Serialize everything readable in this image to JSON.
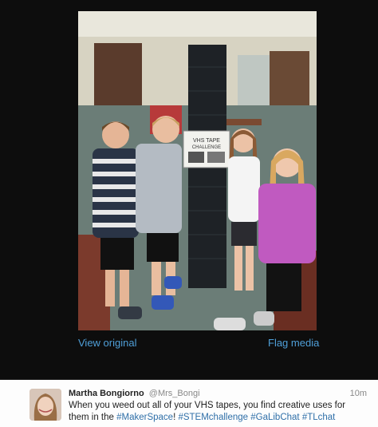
{
  "photo": {
    "sign_title": "VHS TAPE",
    "sign_subtitle": "CHALLENGE"
  },
  "actions": {
    "view_original": "View original",
    "flag_media": "Flag media"
  },
  "tweet": {
    "author_name": "Martha Bongiorno",
    "handle": "@Mrs_Bongi",
    "time": "10m",
    "text_part1": "When you weed out all of your VHS tapes, you find creative uses for them in the ",
    "hashtag_makerspace": "#MakerSpace",
    "text_part2": "! ",
    "hashtag_stem": "#STEMchallenge",
    "hashtag_galibchat": "#GaLibChat",
    "hashtag_tlchat": "#TLchat"
  },
  "colors": {
    "background": "#0d0d0d",
    "link": "#4f9fd8",
    "hashtag": "#2f6fa8",
    "tweet_bg": "#fdfdfd"
  }
}
